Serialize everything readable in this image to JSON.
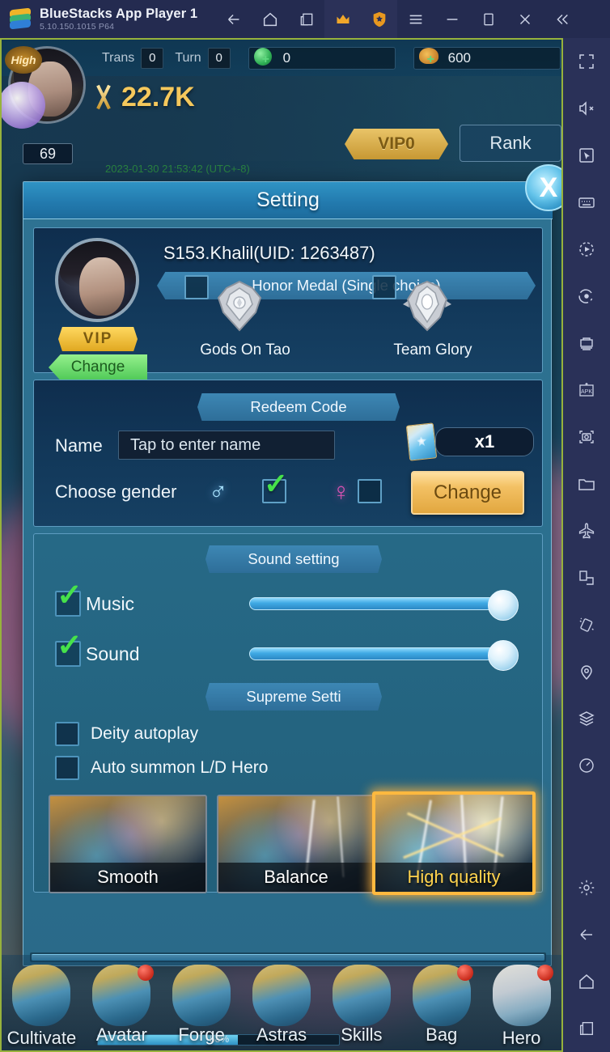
{
  "titlebar": {
    "app_title": "BlueStacks App Player 1",
    "version": "5.10.150.1015  P64",
    "buttons": [
      {
        "name": "back-icon",
        "label": "Back"
      },
      {
        "name": "home-icon",
        "label": "Home"
      },
      {
        "name": "multi-instance-icon",
        "label": "Multi-instance"
      },
      {
        "name": "crown-icon",
        "label": "Premium"
      },
      {
        "name": "shield-icon",
        "label": "Shield"
      },
      {
        "name": "menu-icon",
        "label": "Menu"
      },
      {
        "name": "minimize-icon",
        "label": "Minimize"
      },
      {
        "name": "maximize-icon",
        "label": "Maximize"
      },
      {
        "name": "close-icon",
        "label": "Close"
      },
      {
        "name": "collapse-icon",
        "label": "Collapse"
      }
    ]
  },
  "sidebar": {
    "items": [
      {
        "name": "fullscreen-icon",
        "label": "Fullscreen"
      },
      {
        "name": "mute-icon",
        "label": "Mute"
      },
      {
        "name": "cursor-icon",
        "label": "Cursor"
      },
      {
        "name": "keyboard-icon",
        "label": "Game controls"
      },
      {
        "name": "macro-play-icon",
        "label": "Macro recorder"
      },
      {
        "name": "sync-icon",
        "label": "Sync operations"
      },
      {
        "name": "multi-instance-manager-icon",
        "label": "Instance manager"
      },
      {
        "name": "install-apk-icon",
        "label": "Install APK"
      },
      {
        "name": "screenshot-icon",
        "label": "Screenshot"
      },
      {
        "name": "folder-icon",
        "label": "Media manager"
      },
      {
        "name": "airplane-icon",
        "label": "Eco mode"
      },
      {
        "name": "rotate-screen-icon",
        "label": "Rotate"
      },
      {
        "name": "shake-icon",
        "label": "Shake"
      },
      {
        "name": "location-icon",
        "label": "Location"
      },
      {
        "name": "layers-icon",
        "label": "Layers"
      },
      {
        "name": "performance-icon",
        "label": "Performance"
      },
      {
        "name": "gear-icon",
        "label": "Settings"
      },
      {
        "name": "back-icon",
        "label": "Back"
      },
      {
        "name": "home-icon",
        "label": "Home"
      },
      {
        "name": "recents-icon",
        "label": "Recents"
      }
    ]
  },
  "hud": {
    "player_rank_tag": "High",
    "player_level": "69",
    "trans_label": "Trans",
    "trans_value": "0",
    "turn_label": "Turn",
    "turn_value": "0",
    "gem_value": "0",
    "horn_value": "600",
    "power_value": "22.7K",
    "timestamp": "2023-01-30 21:53:42 (UTC+-8)",
    "vip_label": "VIP0",
    "rank_label": "Rank"
  },
  "dialog": {
    "title": "Setting",
    "close_label": "X",
    "account": {
      "name_uid": "S153.Khalil(UID: 1263487)",
      "medal_band": "Honor Medal (Single choice)",
      "vip_tag": "VIP",
      "change_tag": "Change",
      "medals": [
        {
          "label": "Gods On Tao",
          "checked": false
        },
        {
          "label": "Team Glory",
          "checked": false
        }
      ]
    },
    "redeem": {
      "band": "Redeem Code",
      "name_label": "Name",
      "name_placeholder": "Tap to enter name",
      "name_value": "",
      "item_count": "x1",
      "gender_label": "Choose gender",
      "male_symbol": "♂",
      "female_symbol": "♀",
      "male_checked": true,
      "female_checked": false,
      "change_button": "Change"
    },
    "sound": {
      "band": "Sound setting",
      "rows": [
        {
          "label": "Music",
          "checked": true,
          "value": 100
        },
        {
          "label": "Sound",
          "checked": true,
          "value": 100
        }
      ]
    },
    "supreme": {
      "band": "Supreme Setti",
      "options": [
        {
          "label": "Deity autoplay",
          "checked": false
        },
        {
          "label": "Auto summon L/D Hero",
          "checked": false
        }
      ]
    },
    "quality": {
      "options": [
        {
          "label": "Smooth",
          "selected": false
        },
        {
          "label": "Balance",
          "selected": false
        },
        {
          "label": "High quality",
          "selected": true
        }
      ]
    }
  },
  "bottom_nav": {
    "items": [
      {
        "label": "Cultivate",
        "badge": false
      },
      {
        "label": "Avatar",
        "badge": true
      },
      {
        "label": "Forge",
        "badge": false
      },
      {
        "label": "Astras",
        "badge": false
      },
      {
        "label": "Skills",
        "badge": false
      },
      {
        "label": "Bag",
        "badge": true
      },
      {
        "label": "Hero",
        "badge": true
      }
    ],
    "progress_text": "58%",
    "progress_percent": 58
  }
}
